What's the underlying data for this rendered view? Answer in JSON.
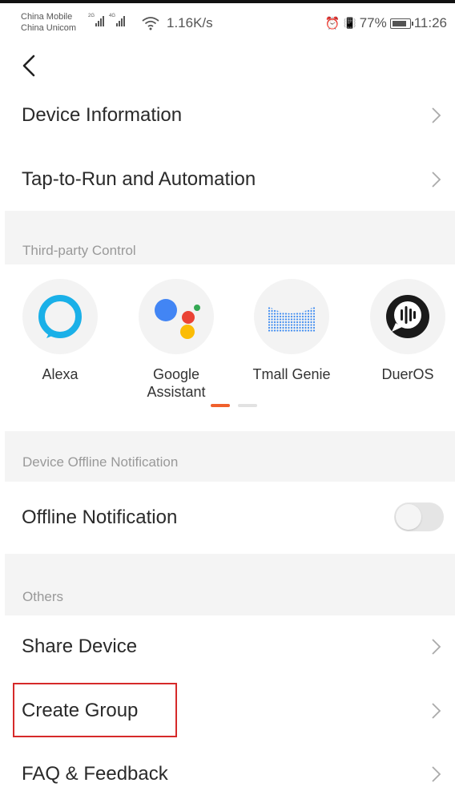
{
  "status_bar": {
    "carrier_1": "China Mobile",
    "carrier_2": "China Unicom",
    "sig1_tag": "2G",
    "sig2_tag": "4G",
    "speed": "1.16K/s",
    "alarm_icon": "⏰",
    "vibrate_icon": "📳",
    "battery": "77%",
    "time": "11:26"
  },
  "nav": {
    "back_icon": "back-chevron-icon"
  },
  "menu": {
    "device_information": "Device Information",
    "tap_to_run": "Tap-to-Run and Automation"
  },
  "third_party": {
    "section_title": "Third-party Control",
    "items": [
      {
        "label": "Alexa",
        "icon": "alexa-icon"
      },
      {
        "label": "Google\nAssistant",
        "icon": "google-assistant-icon"
      },
      {
        "label": "Tmall Genie",
        "icon": "tmall-genie-icon"
      },
      {
        "label": "DuerOS",
        "icon": "dueros-icon"
      }
    ],
    "page_indicator": {
      "pages": 2,
      "active": 0
    }
  },
  "offline": {
    "section_title": "Device Offline Notification",
    "label": "Offline Notification",
    "enabled": false
  },
  "others": {
    "section_title": "Others",
    "share_device": "Share Device",
    "create_group": "Create Group",
    "faq": "FAQ & Feedback"
  },
  "colors": {
    "accent": "#f0602c",
    "highlight_box": "#d62a2a",
    "section_bg": "#f4f4f4",
    "alexa_blue": "#1ab0e8"
  }
}
